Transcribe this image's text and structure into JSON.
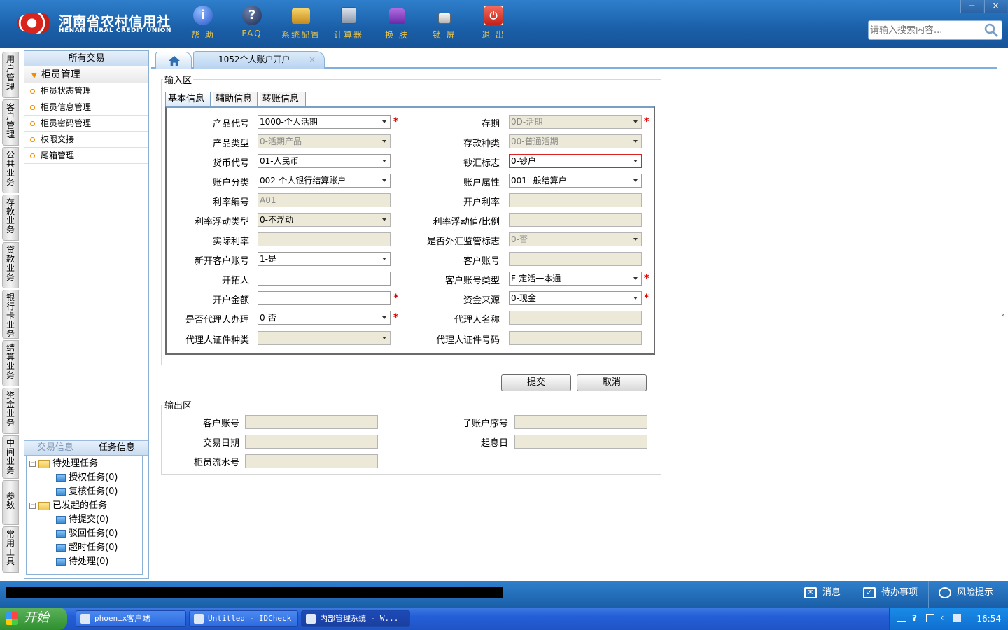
{
  "header": {
    "logo_cn": "河南省农村信用社",
    "logo_en": "HENAN RURAL CREDIT UNION",
    "tools": [
      {
        "label": "帮 助",
        "icon": "info-icon"
      },
      {
        "label": "FAQ",
        "icon": "question-icon"
      },
      {
        "label": "系统配置",
        "icon": "toolbox-icon"
      },
      {
        "label": "计算器",
        "icon": "calculator-icon"
      },
      {
        "label": "换 肤",
        "icon": "shirt-icon"
      },
      {
        "label": "锁 屏",
        "icon": "lock-icon"
      },
      {
        "label": "退 出",
        "icon": "power-icon"
      }
    ],
    "search_placeholder": "请输入搜索内容...",
    "window_buttons": [
      "−",
      "×"
    ]
  },
  "vtabs": [
    "用户管理",
    "客户管理",
    "公共业务",
    "存款业务",
    "贷款业务",
    "银行卡业务",
    "结算业务",
    "资金业务",
    "中间业务",
    "参数",
    "常用工具"
  ],
  "nav": {
    "header": "所有交易",
    "group": "柜员管理",
    "items": [
      "柜员状态管理",
      "柜员信息管理",
      "柜员密码管理",
      "权限交接",
      "尾箱管理"
    ],
    "task_tabs": [
      "交易信息",
      "任务信息"
    ],
    "tree": {
      "pending": "待处理任务",
      "pending_children": [
        "授权任务(0)",
        "复核任务(0)"
      ],
      "initiated": "已发起的任务",
      "initiated_children": [
        "待提交(0)",
        "驳回任务(0)",
        "超时任务(0)",
        "待处理(0)"
      ]
    }
  },
  "content": {
    "tab_title": "1052个人账户开户",
    "tab_close": "×",
    "input_area_label": "输入区",
    "subtabs": [
      "基本信息",
      "辅助信息",
      "转账信息"
    ],
    "form_left": [
      {
        "label": "产品代号",
        "value": "1000-个人活期"
      },
      {
        "label": "产品类型",
        "value": "0-活期产品"
      },
      {
        "label": "货币代号",
        "value": "01-人民币"
      },
      {
        "label": "账户分类",
        "value": "002-个人银行结算账户"
      },
      {
        "label": "利率编号",
        "value": "A01"
      },
      {
        "label": "利率浮动类型",
        "value": "0-不浮动"
      },
      {
        "label": "实际利率",
        "value": ""
      },
      {
        "label": "新开客户账号",
        "value": "1-是"
      },
      {
        "label": "开拓人",
        "value": ""
      },
      {
        "label": "开户金额",
        "value": ""
      },
      {
        "label": "是否代理人办理",
        "value": "0-否"
      },
      {
        "label": "代理人证件种类",
        "value": ""
      }
    ],
    "form_right": [
      {
        "label": "存期",
        "value": "0D-活期"
      },
      {
        "label": "存款种类",
        "value": "00-普通活期"
      },
      {
        "label": "钞汇标志",
        "value": "0-钞户"
      },
      {
        "label": "账户属性",
        "value": "001--般结算户"
      },
      {
        "label": "开户利率",
        "value": ""
      },
      {
        "label": "利率浮动值/比例",
        "value": ""
      },
      {
        "label": "是否外汇监管标志",
        "value": "0-否"
      },
      {
        "label": "客户账号",
        "value": ""
      },
      {
        "label": "客户账号类型",
        "value": "F-定活一本通"
      },
      {
        "label": "资金来源",
        "value": "0-现金"
      },
      {
        "label": "代理人名称",
        "value": ""
      },
      {
        "label": "代理人证件号码",
        "value": ""
      }
    ],
    "required_mark": "*",
    "submit_label": "提交",
    "cancel_label": "取消",
    "output_area_label": "输出区",
    "output_fields": [
      {
        "label": "客户账号",
        "value": ""
      },
      {
        "label": "子账户序号",
        "value": ""
      },
      {
        "label": "交易日期",
        "value": ""
      },
      {
        "label": "起息日",
        "value": ""
      },
      {
        "label": "柜员流水号",
        "value": ""
      }
    ]
  },
  "statusbar": {
    "buttons": [
      "消息",
      "待办事项",
      "风险提示"
    ]
  },
  "taskbar": {
    "start_label": "开始",
    "tasks": [
      "phoenix客户端",
      "Untitled - IDCheck",
      "内部管理系统 - W..."
    ],
    "clock": "16:54",
    "colors": {
      "accent": "#1a5fa8",
      "required": "#dd0000",
      "highlight_border": "#dd2222"
    }
  }
}
